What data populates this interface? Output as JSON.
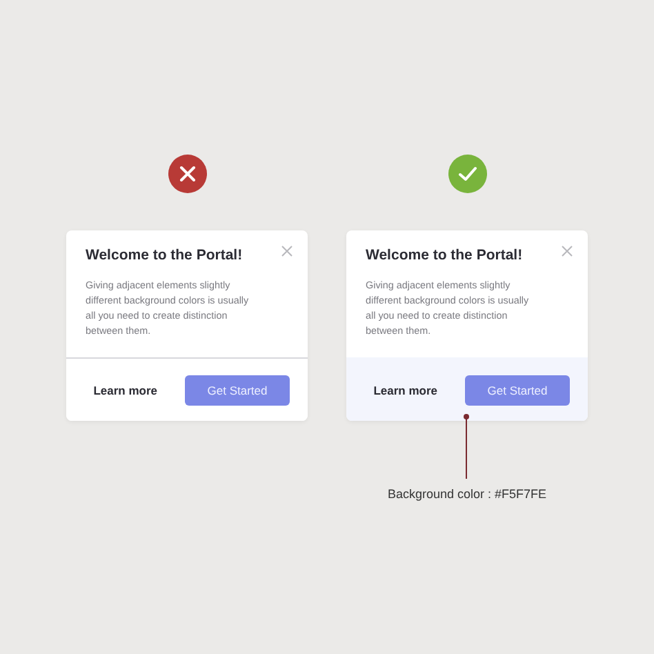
{
  "examples": [
    {
      "kind": "bad",
      "title": "Welcome to the Portal!",
      "body": "Giving adjacent elements slightly different background colors is usually all you need to create distinction between them.",
      "footer_tinted": false,
      "secondary_button": "Learn more",
      "primary_button": "Get Started"
    },
    {
      "kind": "good",
      "title": "Welcome to the Portal!",
      "body": "Giving adjacent elements slightly different background colors is usually all you need to create distinction between them.",
      "footer_tinted": true,
      "secondary_button": "Learn more",
      "primary_button": "Get Started",
      "annotation": "Background color : #F5F7FE"
    }
  ]
}
